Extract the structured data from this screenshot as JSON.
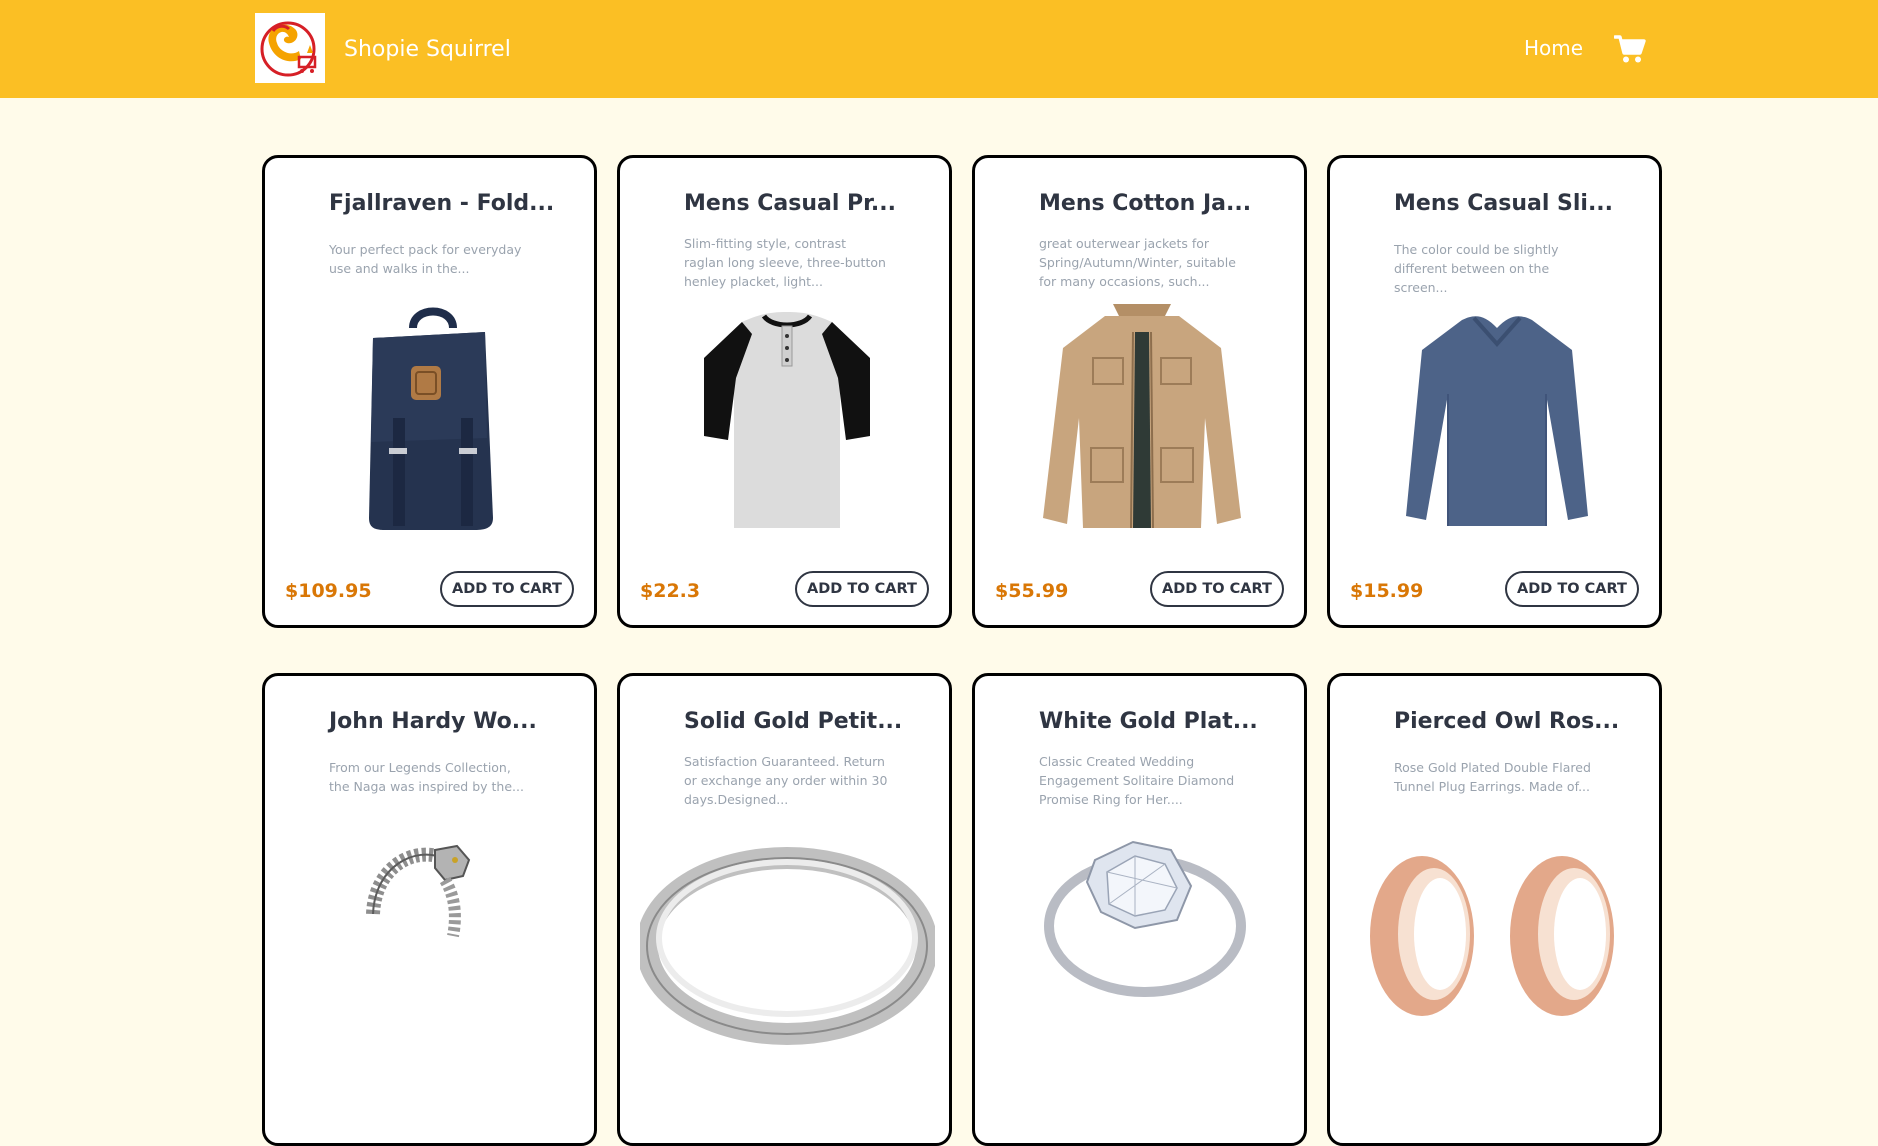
{
  "header": {
    "brand": "Shopie Squirrel",
    "home_label": "Home",
    "cart_icon": "cart-icon",
    "logo_icon": "squirrel-cart-logo",
    "background": "#fbbf24"
  },
  "colors": {
    "page_background": "#fffbea",
    "price": "#d97706",
    "title": "#2f3542",
    "description": "#9aa3ae",
    "card_border": "#000000"
  },
  "products": [
    {
      "title": "Fjallraven - Fold...",
      "description": "Your perfect pack for everyday use and walks in the...",
      "price": "$109.95",
      "button": "ADD TO CART",
      "image": "navy-backpack"
    },
    {
      "title": "Mens Casual Pr...",
      "description": "Slim-fitting style, contrast raglan long sleeve, three-button henley placket, light...",
      "price": "$22.3",
      "button": "ADD TO CART",
      "image": "raglan-henley-shirt"
    },
    {
      "title": "Mens Cotton Ja...",
      "description": "great outerwear jackets for Spring/Autumn/Winter, suitable for many occasions, such...",
      "price": "$55.99",
      "button": "ADD TO CART",
      "image": "khaki-cotton-jacket"
    },
    {
      "title": "Mens Casual Sli...",
      "description": "The color could be slightly different between on the screen...",
      "price": "$15.99",
      "button": "ADD TO CART",
      "image": "blue-long-sleeve-shirt"
    },
    {
      "title": "John Hardy Wo...",
      "description": "From our Legends Collection, the Naga was inspired by the...",
      "image": "dragon-chain-bracelet"
    },
    {
      "title": "Solid Gold Petit...",
      "description": "Satisfaction Guaranteed. Return or exchange any order within 30 days.Designed...",
      "image": "silver-band-ring"
    },
    {
      "title": "White Gold Plat...",
      "description": "Classic Created Wedding Engagement Solitaire Diamond Promise Ring for Her....",
      "image": "diamond-solitaire-ring"
    },
    {
      "title": "Pierced Owl Ros...",
      "description": "Rose Gold Plated Double Flared Tunnel Plug Earrings. Made of...",
      "image": "rose-gold-plug-earrings"
    }
  ]
}
